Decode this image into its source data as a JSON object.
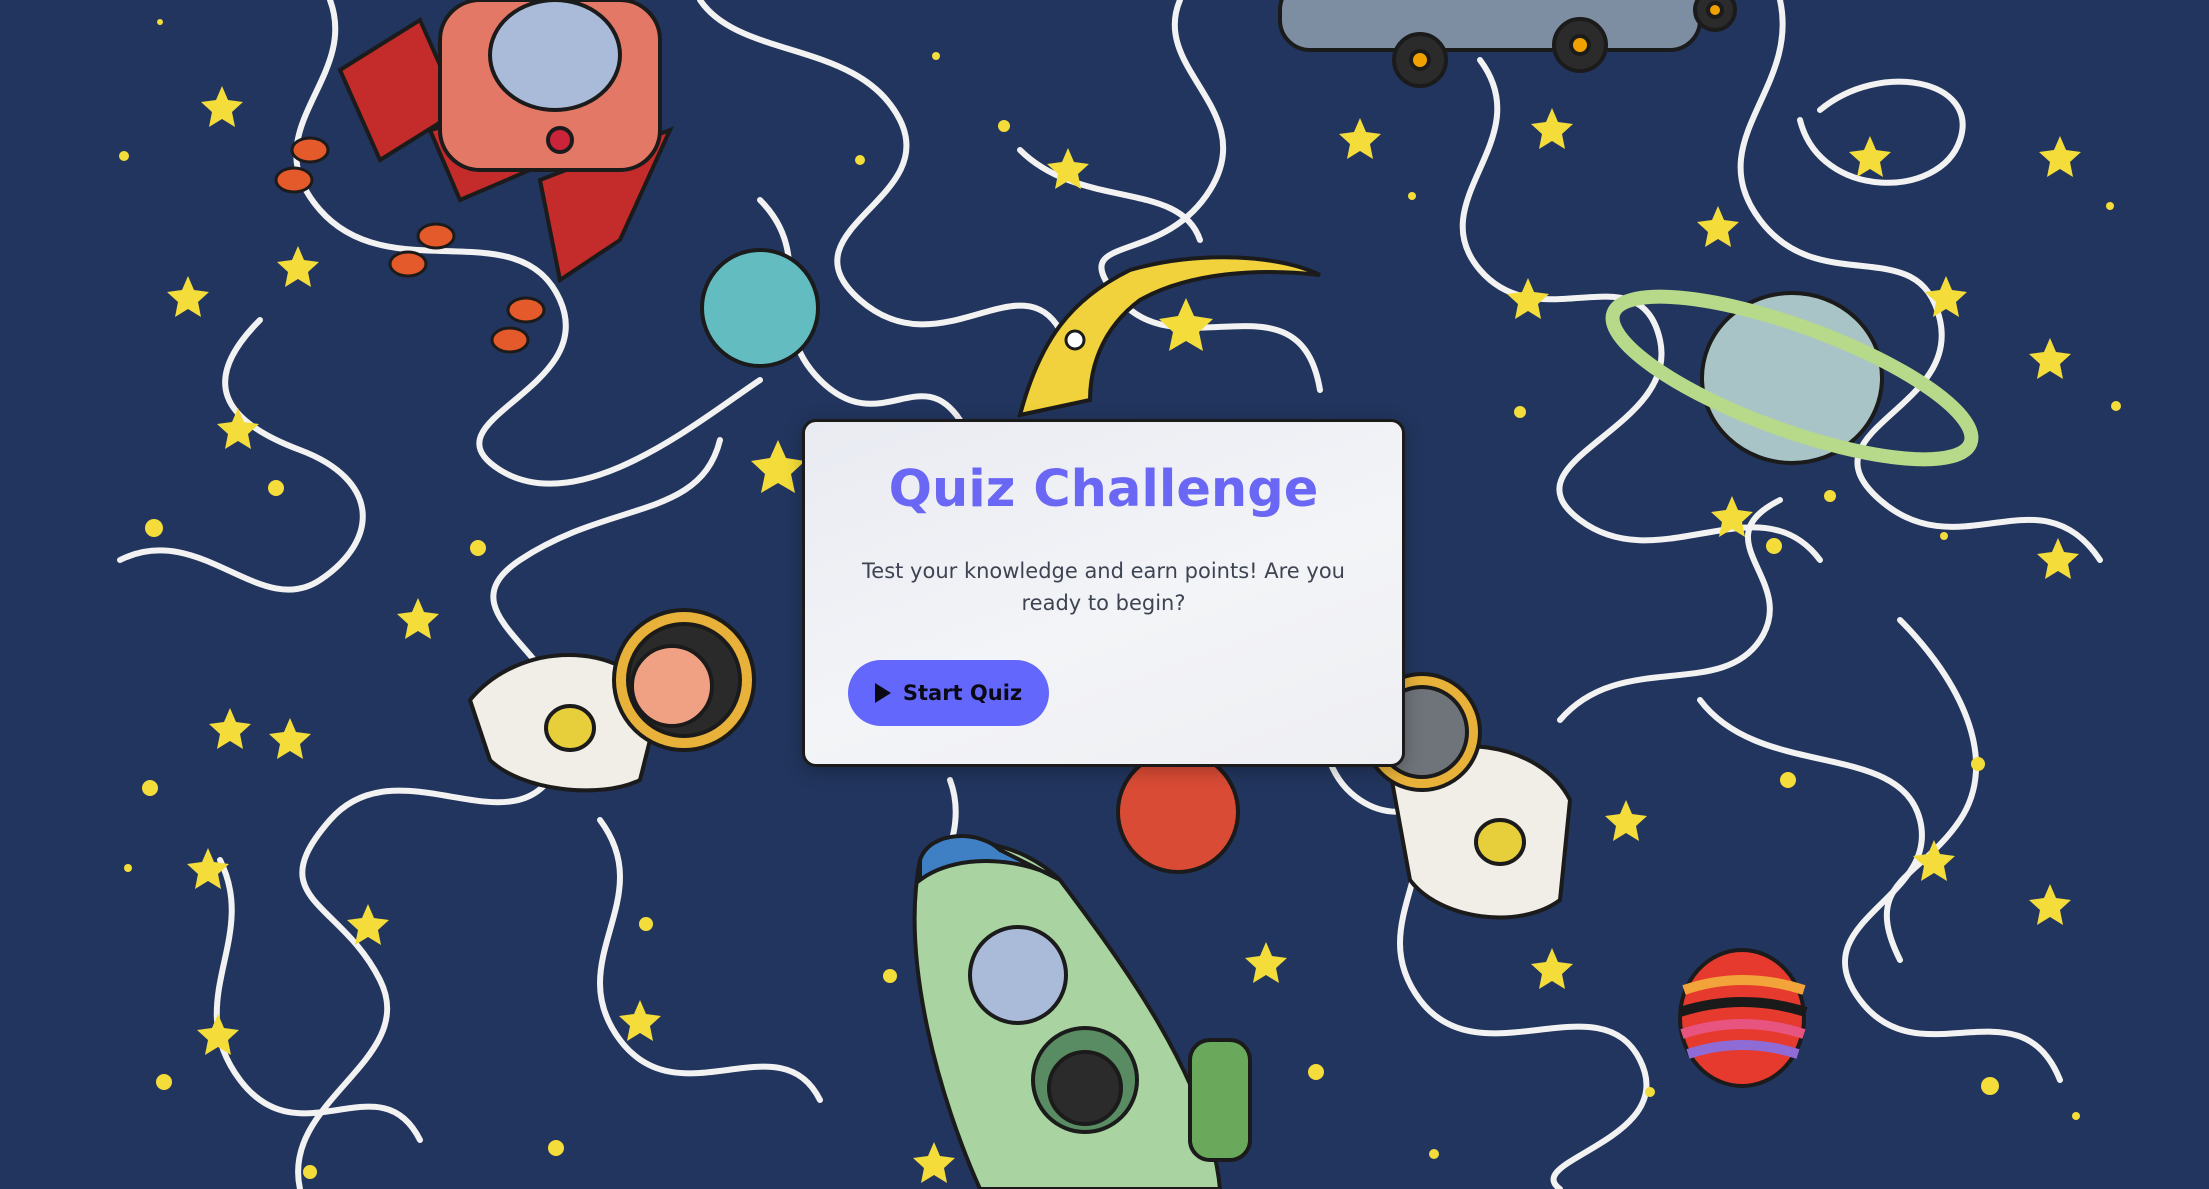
{
  "quiz": {
    "title": "Quiz Challenge",
    "description": "Test your knowledge and earn points! Are you ready to begin?",
    "start_label": "Start Quiz",
    "start_icon": "play-icon"
  },
  "colors": {
    "background": "#22355e",
    "title": "#6a67f4",
    "button": "#6467fb",
    "star": "#f4dd3a"
  }
}
